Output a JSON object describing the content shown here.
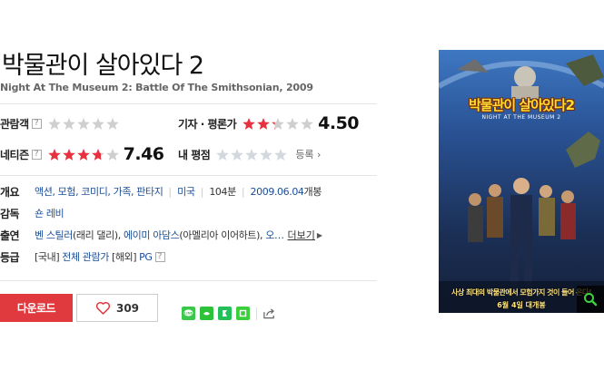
{
  "movie": {
    "title": "박물관이 살아있다 2",
    "original_title": "Night At The Museum 2: Battle Of The Smithsonian, 2009"
  },
  "ratings": {
    "audience": {
      "label": "관람객",
      "help": "?",
      "stars": 0,
      "max": 5
    },
    "critic": {
      "label": "기자 · 평론가",
      "stars": 2.25,
      "max": 5,
      "score": "4.50"
    },
    "netizen": {
      "label": "네티즌",
      "help": "?",
      "stars": 3.73,
      "max": 5,
      "score": "7.46"
    },
    "my": {
      "label": "내 평점",
      "stars": 0,
      "max": 5,
      "register_label": "등록"
    }
  },
  "info": {
    "overview": {
      "label": "개요",
      "genres": "액션, 모험, 코미디, 가족, 판타지",
      "country": "미국",
      "runtime": "104분",
      "release_date": "2009.06.04",
      "release_suffix": "개봉"
    },
    "director": {
      "label": "감독",
      "value": "숀 레비"
    },
    "cast": {
      "label": "출연",
      "actor1": "벤 스틸러",
      "role1": "(래리 댈리)",
      "actor2": "에이미 아담스",
      "role2": "(아멜리아 이어하트)",
      "actor3": "오…",
      "more_label": "더보기"
    },
    "grade": {
      "label": "등급",
      "domestic_tag": "[국내]",
      "domestic_value": "전체 관람가",
      "foreign_tag": "[해외]",
      "foreign_value": "PG",
      "help": "?"
    }
  },
  "actions": {
    "download_label": "다운로드",
    "like_count": "309"
  },
  "share": {
    "icons": [
      "line-icon",
      "band-icon",
      "kakaostory-icon",
      "green-square-icon",
      "share-icon"
    ],
    "colors": {
      "line": "#3ac84b",
      "band": "#2ec23a",
      "kakao": "#23c05a",
      "green": "#39d039"
    }
  },
  "poster": {
    "title_text": "박물관이 살아있다2",
    "subtitle_text": "NIGHT AT THE MUSEUM 2",
    "tagline": "사상 최대의 박물관에서 모험가지 것이 들어 온다!",
    "date_text": "6월 4일 대개봉"
  },
  "colors": {
    "accent_red": "#e0393e",
    "link_blue": "#1a4e9a",
    "star_red": "#e8313e",
    "star_gray": "#cfcfcf"
  }
}
